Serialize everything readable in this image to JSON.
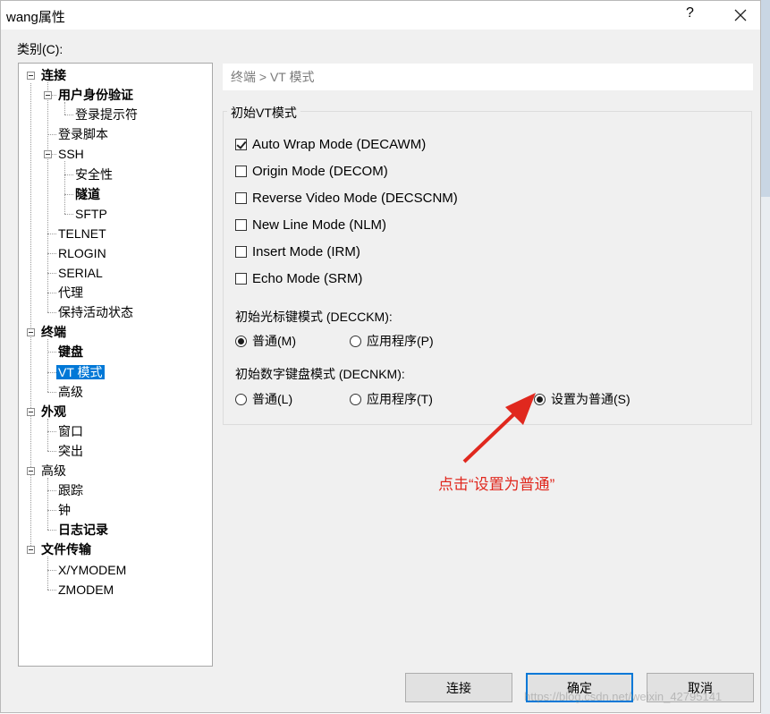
{
  "window": {
    "title": "wang属性",
    "help": "?",
    "close": "✕"
  },
  "category_label": "类别(C):",
  "tree": [
    {
      "label": "连接",
      "bold": true
    },
    {
      "label": "用户身份验证",
      "bold": true
    },
    {
      "label": "登录提示符",
      "bold": false
    },
    {
      "label": "登录脚本",
      "bold": false
    },
    {
      "label": "SSH",
      "bold": false
    },
    {
      "label": "安全性",
      "bold": false
    },
    {
      "label": "隧道",
      "bold": true
    },
    {
      "label": "SFTP",
      "bold": false
    },
    {
      "label": "TELNET",
      "bold": false
    },
    {
      "label": "RLOGIN",
      "bold": false
    },
    {
      "label": "SERIAL",
      "bold": false
    },
    {
      "label": "代理",
      "bold": false
    },
    {
      "label": "保持活动状态",
      "bold": false
    },
    {
      "label": "终端",
      "bold": true
    },
    {
      "label": "键盘",
      "bold": true
    },
    {
      "label": "VT 模式",
      "bold": false,
      "selected": true
    },
    {
      "label": "高级",
      "bold": false
    },
    {
      "label": "外观",
      "bold": true
    },
    {
      "label": "窗口",
      "bold": false
    },
    {
      "label": "突出",
      "bold": false
    },
    {
      "label": "高级",
      "bold": false
    },
    {
      "label": "跟踪",
      "bold": false
    },
    {
      "label": "钟",
      "bold": false
    },
    {
      "label": "日志记录",
      "bold": true
    },
    {
      "label": "文件传输",
      "bold": true
    },
    {
      "label": "X/YMODEM",
      "bold": false
    },
    {
      "label": "ZMODEM",
      "bold": false
    }
  ],
  "breadcrumb": "终端 > VT 模式",
  "group_title": "初始VT模式",
  "checkboxes": [
    {
      "label": "Auto Wrap Mode (DECAWM)",
      "checked": true
    },
    {
      "label": "Origin Mode (DECOM)",
      "checked": false
    },
    {
      "label": "Reverse Video Mode (DECSCNM)",
      "checked": false
    },
    {
      "label": "New Line Mode (NLM)",
      "checked": false
    },
    {
      "label": "Insert Mode (IRM)",
      "checked": false
    },
    {
      "label": "Echo Mode (SRM)",
      "checked": false
    }
  ],
  "cursor_keys": {
    "label": "初始光标键模式 (DECCKM):",
    "options": [
      {
        "label": "普通(M)",
        "checked": true
      },
      {
        "label": "应用程序(P)",
        "checked": false
      }
    ]
  },
  "keypad": {
    "label": "初始数字键盘模式 (DECNKM):",
    "options": [
      {
        "label": "普通(L)",
        "checked": false
      },
      {
        "label": "应用程序(T)",
        "checked": false
      },
      {
        "label": "设置为普通(S)",
        "checked": true
      }
    ]
  },
  "annotation": "点击“设置为普通”",
  "buttons": {
    "connect": "连接",
    "ok": "确定",
    "cancel": "取消"
  },
  "watermark": "https://blog.csdn.net/weixin_42795141",
  "colors": {
    "selection": "#0078d7",
    "annotation": "#e0281e"
  }
}
